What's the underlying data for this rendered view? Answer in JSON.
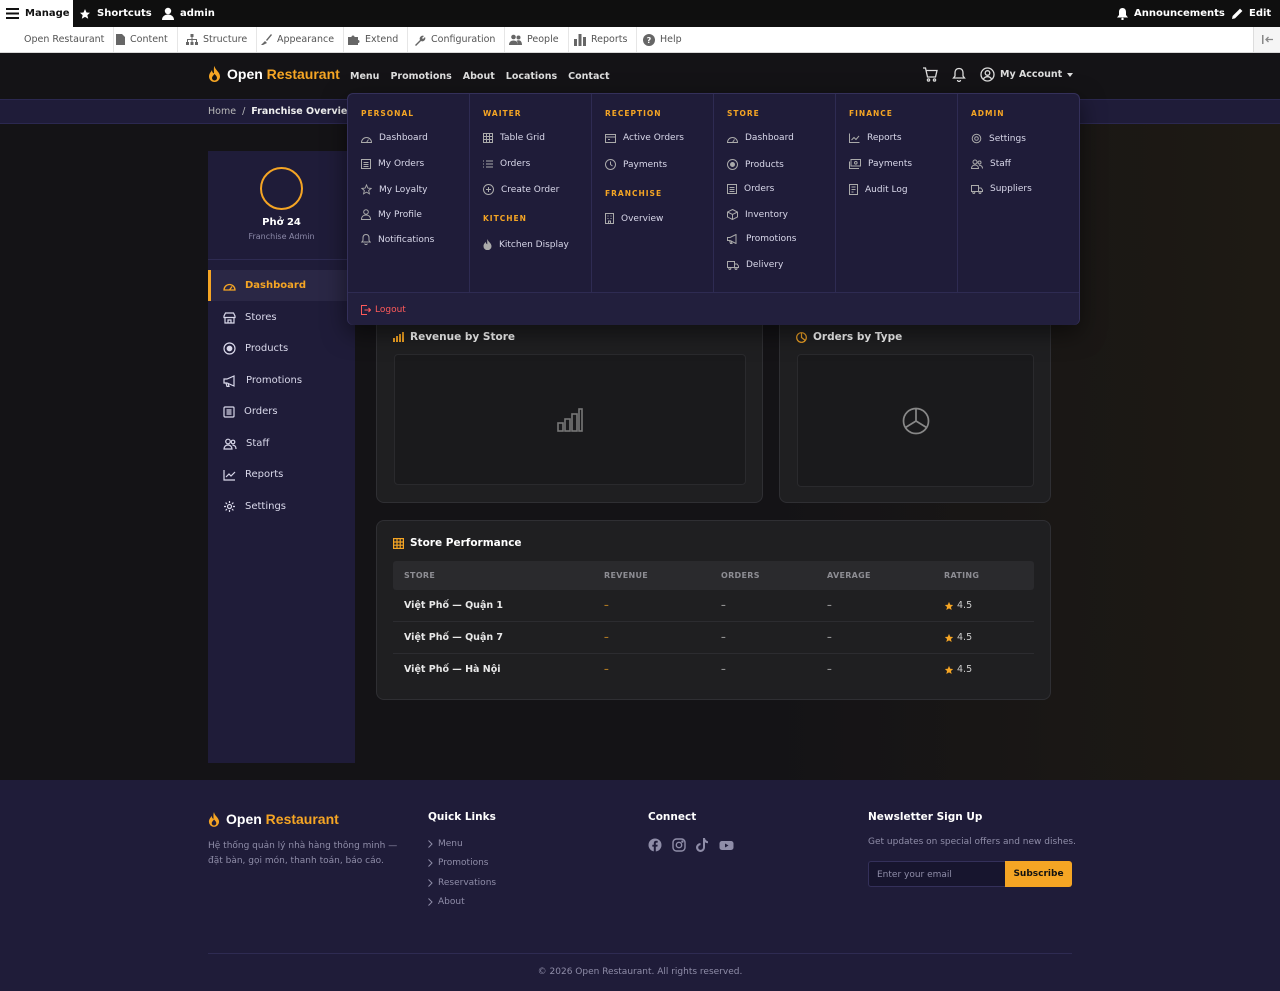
{
  "admin_bar": {
    "manage": "Manage",
    "shortcuts": "Shortcuts",
    "user": "admin",
    "announcements": "Announcements",
    "edit": "Edit"
  },
  "admin_toolbar": {
    "items": [
      "Open Restaurant",
      "Content",
      "Structure",
      "Appearance",
      "Extend",
      "Configuration",
      "People",
      "Reports",
      "Help"
    ]
  },
  "site": {
    "logo_open": "Open",
    "logo_restaurant": "Restaurant",
    "nav": [
      "Menu",
      "Promotions",
      "About",
      "Locations",
      "Contact"
    ],
    "account": "My Account"
  },
  "breadcrumb": {
    "home": "Home",
    "separator": "/",
    "current": "Franchise Overview"
  },
  "sidebar": {
    "name": "Phở 24",
    "role": "Franchise Admin",
    "items": [
      {
        "label": "Dashboard",
        "icon": "dashboard-icon",
        "active": true
      },
      {
        "label": "Stores",
        "icon": "store-icon"
      },
      {
        "label": "Products",
        "icon": "product-icon"
      },
      {
        "label": "Promotions",
        "icon": "megaphone-icon"
      },
      {
        "label": "Orders",
        "icon": "orders-icon"
      },
      {
        "label": "Staff",
        "icon": "staff-icon"
      },
      {
        "label": "Reports",
        "icon": "chart-line-icon"
      },
      {
        "label": "Settings",
        "icon": "gear-icon"
      }
    ]
  },
  "dropdown": {
    "columns": [
      {
        "sections": [
          {
            "heading": "PERSONAL",
            "items": [
              "Dashboard",
              "My Orders",
              "My Loyalty",
              "My Profile",
              "Notifications"
            ]
          }
        ]
      },
      {
        "sections": [
          {
            "heading": "WAITER",
            "items": [
              "Table Grid",
              "Orders",
              "Create Order"
            ]
          },
          {
            "heading": "KITCHEN",
            "items": [
              "Kitchen Display"
            ]
          }
        ]
      },
      {
        "sections": [
          {
            "heading": "RECEPTION",
            "items": [
              "Active Orders",
              "Payments"
            ]
          },
          {
            "heading": "FRANCHISE",
            "items": [
              "Overview"
            ]
          }
        ]
      },
      {
        "sections": [
          {
            "heading": "STORE",
            "items": [
              "Dashboard",
              "Products",
              "Orders",
              "Inventory",
              "Promotions",
              "Delivery"
            ]
          }
        ]
      },
      {
        "sections": [
          {
            "heading": "FINANCE",
            "items": [
              "Reports",
              "Payments",
              "Audit Log"
            ]
          }
        ]
      },
      {
        "sections": [
          {
            "heading": "ADMIN",
            "items": [
              "Settings",
              "Staff",
              "Suppliers"
            ]
          }
        ]
      }
    ],
    "logout": "Logout"
  },
  "revenue_card": {
    "title": "Revenue by Store"
  },
  "orders_card": {
    "title": "Orders by Type"
  },
  "performance": {
    "title": "Store Performance",
    "columns": [
      "STORE",
      "REVENUE",
      "ORDERS",
      "AVERAGE",
      "RATING"
    ],
    "rows": [
      {
        "store": "Việt Phố — Quận 1",
        "revenue": "–",
        "orders": "–",
        "average": "–",
        "rating": "4.5"
      },
      {
        "store": "Việt Phố — Quận 7",
        "revenue": "–",
        "orders": "–",
        "average": "–",
        "rating": "4.5"
      },
      {
        "store": "Việt Phố — Hà Nội",
        "revenue": "–",
        "orders": "–",
        "average": "–",
        "rating": "4.5"
      }
    ]
  },
  "footer": {
    "logo_open": "Open",
    "logo_restaurant": "Restaurant",
    "description": "Hệ thống quản lý nhà hàng thông minh — đặt bàn, gọi món, thanh toán, báo cáo.",
    "quick_links_heading": "Quick Links",
    "quick_links": [
      "Menu",
      "Promotions",
      "Reservations",
      "About"
    ],
    "connect_heading": "Connect",
    "social": [
      "facebook-icon",
      "instagram-icon",
      "tiktok-icon",
      "youtube-icon"
    ],
    "newsletter_heading": "Newsletter Sign Up",
    "newsletter_text": "Get updates on special offers and new dishes.",
    "email_placeholder": "Enter your email",
    "subscribe": "Subscribe",
    "copyright": "© 2026 Open Restaurant. All rights reserved."
  },
  "colors": {
    "accent": "#f5a524",
    "navy": "#1f1c39",
    "danger": "#ff5a5a"
  }
}
